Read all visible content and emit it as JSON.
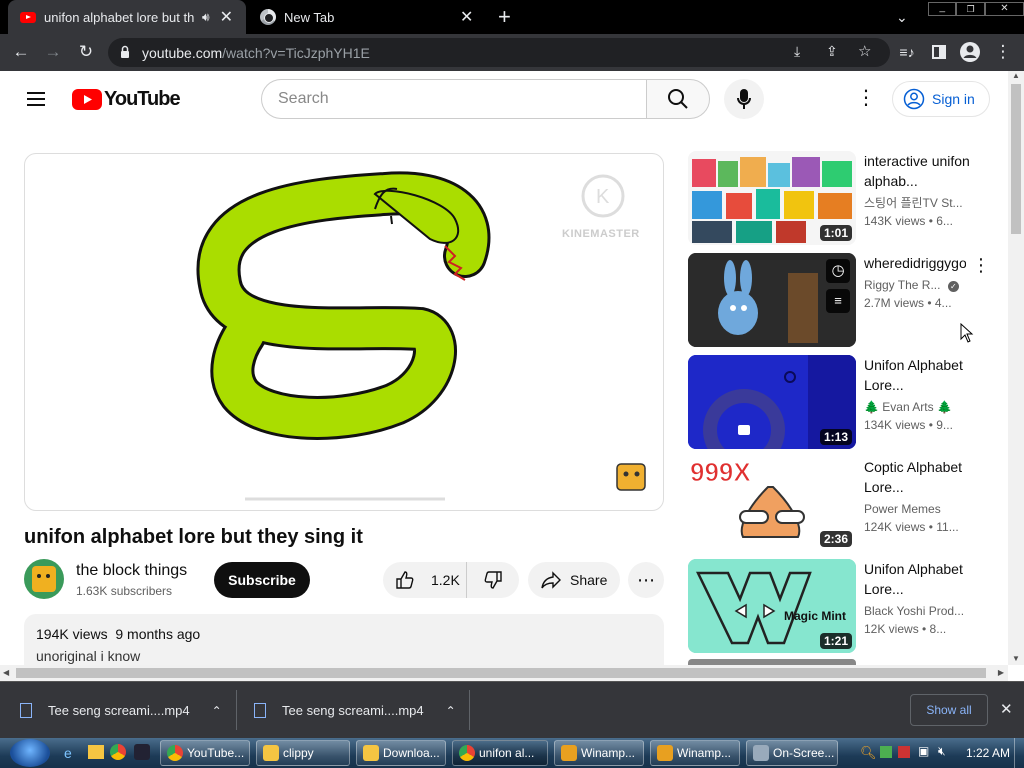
{
  "browser": {
    "tabs": [
      {
        "title": "unifon alphabet lore but they",
        "active": true
      },
      {
        "title": "New Tab",
        "active": false
      }
    ],
    "new_tab_symbol": "+",
    "url_host": "youtube.com",
    "url_path": "/watch?v=TicJzphYH1E"
  },
  "youtube": {
    "logo_text": "YouTube",
    "search_placeholder": "Search",
    "sign_in": "Sign in",
    "video": {
      "title": "unifon alphabet lore but they sing it",
      "watermark": "KINEMASTER",
      "channel": "the block things",
      "subscribers": "1.63K subscribers",
      "subscribe_label": "Subscribe",
      "likes": "1.2K",
      "share_label": "Share",
      "views": "194K views",
      "age": "9 months ago",
      "description": "unoriginal i know"
    },
    "recommendations": [
      {
        "title": "interactive unifon alphab...",
        "channel": "스팅어 플린TV St...",
        "meta": "143K views  • 6...",
        "duration": "1:01"
      },
      {
        "title": "wheredidriggygo",
        "channel": "Riggy The R...",
        "meta": "2.7M views  • 4...",
        "duration": "",
        "verified": true
      },
      {
        "title": "Unifon Alphabet Lore...",
        "channel": "🌲 Evan Arts 🌲",
        "meta": "134K views  • 9...",
        "duration": "1:13"
      },
      {
        "title": "Coptic Alphabet Lore...",
        "channel": "Power Memes",
        "meta": "124K views  • 11...",
        "duration": "2:36",
        "badge": "999X"
      },
      {
        "title": "Unifon Alphabet Lore...",
        "channel": "Black Yoshi Prod...",
        "meta": "12K views  • 8...",
        "duration": "1:21",
        "badge": "Magic Mint"
      }
    ]
  },
  "downloads": {
    "items": [
      "Tee seng screami....mp4",
      "Tee seng screami....mp4"
    ],
    "show_all": "Show all"
  },
  "taskbar": {
    "items": [
      "YouTube...",
      "clippy",
      "Downloa...",
      "unifon al...",
      "Winamp...",
      "Winamp...",
      "On-Scree..."
    ],
    "clock": "1:22 AM"
  },
  "colors": {
    "youtube_red": "#ff0000",
    "link_blue": "#065fd4",
    "snake_green": "#aadd00"
  }
}
